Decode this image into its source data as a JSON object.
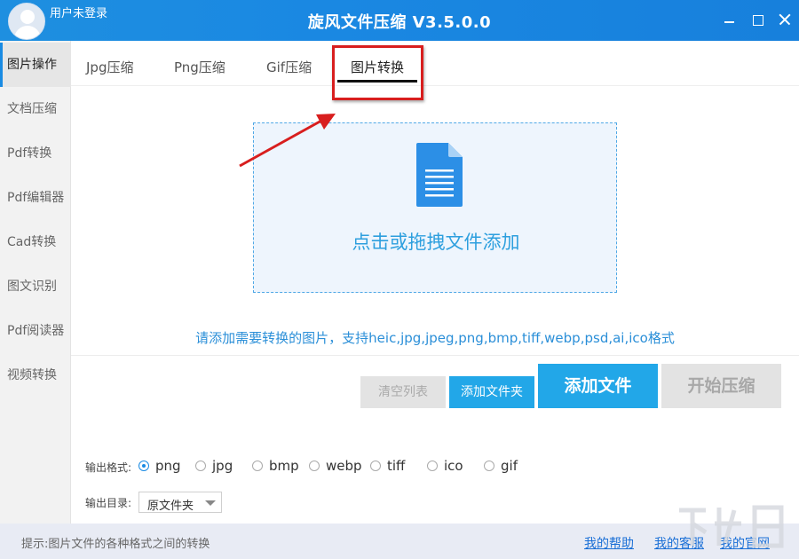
{
  "titlebar": {
    "user_label": "用户未登录",
    "title": "旋风文件压缩 V3.5.0.0"
  },
  "sidebar": {
    "items": [
      {
        "label": "图片操作",
        "active": true
      },
      {
        "label": "文档压缩"
      },
      {
        "label": "Pdf转换"
      },
      {
        "label": "Pdf编辑器"
      },
      {
        "label": "Cad转换"
      },
      {
        "label": "图文识别"
      },
      {
        "label": "Pdf阅读器"
      },
      {
        "label": "视频转换"
      }
    ]
  },
  "tabs": [
    {
      "label": "Jpg压缩"
    },
    {
      "label": "Png压缩"
    },
    {
      "label": "Gif压缩"
    },
    {
      "label": "图片转换",
      "active": true
    }
  ],
  "dropzone": {
    "icon": "document-icon",
    "text": "点击或拖拽文件添加"
  },
  "hint": "请添加需要转换的图片，支持heic,jpg,jpeg,png,bmp,tiff,webp,psd,ai,ico格式",
  "buttons": {
    "clear": "清空列表",
    "add_folder": "添加文件夹",
    "add_file": "添加文件",
    "start": "开始压缩"
  },
  "output_format": {
    "label": "输出格式:",
    "options": [
      "png",
      "jpg",
      "bmp",
      "webp",
      "tiff",
      "ico",
      "gif"
    ],
    "selected": "png"
  },
  "output_dir": {
    "label": "输出目录:",
    "value": "原文件夹"
  },
  "footer": {
    "tip": "提示:图片文件的各种格式之间的转换",
    "links": [
      "我的帮助",
      "我的客服",
      "我的官网"
    ]
  },
  "colors": {
    "accent": "#22a7e8",
    "title_bar": "#1a88e2",
    "highlight": "#d81e1e"
  }
}
